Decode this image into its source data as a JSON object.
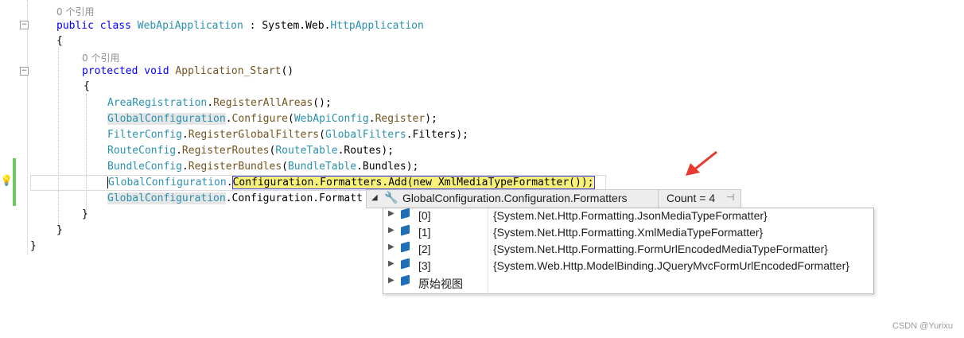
{
  "editor": {
    "ref_count_class": "0 个引用",
    "ref_count_method": "0 个引用",
    "lines": {
      "class_decl": {
        "kw1": "public",
        "kw2": "class",
        "name": "WebApiApplication",
        "sep": " : ",
        "ns": "System.Web.",
        "base": "HttpApplication"
      },
      "brace_open_1": "{",
      "method_decl": {
        "kw1": "protected",
        "kw2": "void",
        "name": "Application_Start",
        "rest": "()"
      },
      "brace_open_2": "{",
      "l1": {
        "t": "AreaRegistration",
        "dot": ".",
        "m": "RegisterAllAreas",
        "rest": "();"
      },
      "l2": {
        "t": "GlobalConfiguration",
        "dot": ".",
        "m": "Configure",
        "p": "(",
        "t2": "WebApiConfig",
        "dot2": ".",
        "m2": "Register",
        "rest": ");"
      },
      "l3": {
        "t": "FilterConfig",
        "dot": ".",
        "m": "RegisterGlobalFilters",
        "p": "(",
        "t2": "GlobalFilters",
        "rest": ".Filters);"
      },
      "l4": {
        "t": "RouteConfig",
        "dot": ".",
        "m": "RegisterRoutes",
        "p": "(",
        "t2": "RouteTable",
        "rest": ".Routes);"
      },
      "l5": {
        "t": "BundleConfig",
        "dot": ".",
        "m": "RegisterBundles",
        "p": "(",
        "t2": "BundleTable",
        "rest": ".Bundles);"
      },
      "l6": {
        "t": "GlobalConfiguration",
        "dot": ".",
        "rest": "Configuration.Formatters.Add(new XmlMediaTypeFormatter());"
      },
      "l7": {
        "t": "GlobalConfiguration",
        "rest": ".Configuration.Formatt"
      },
      "brace_close_2": "}",
      "brace_close_1": "}",
      "brace_close_0": "}"
    }
  },
  "datatip": {
    "expression": "GlobalConfiguration.Configuration.Formatters",
    "count": "Count = 4",
    "rows": [
      {
        "name": "[0]",
        "value": "{System.Net.Http.Formatting.JsonMediaTypeFormatter}"
      },
      {
        "name": "[1]",
        "value": "{System.Net.Http.Formatting.XmlMediaTypeFormatter}"
      },
      {
        "name": "[2]",
        "value": "{System.Net.Http.Formatting.FormUrlEncodedMediaTypeFormatter}"
      },
      {
        "name": "[3]",
        "value": "{System.Web.Http.ModelBinding.JQueryMvcFormUrlEncodedFormatter}"
      },
      {
        "name": "原始视图",
        "value": ""
      }
    ]
  },
  "annotation_color": "#e8392f",
  "watermark": "CSDN @Yurixu"
}
